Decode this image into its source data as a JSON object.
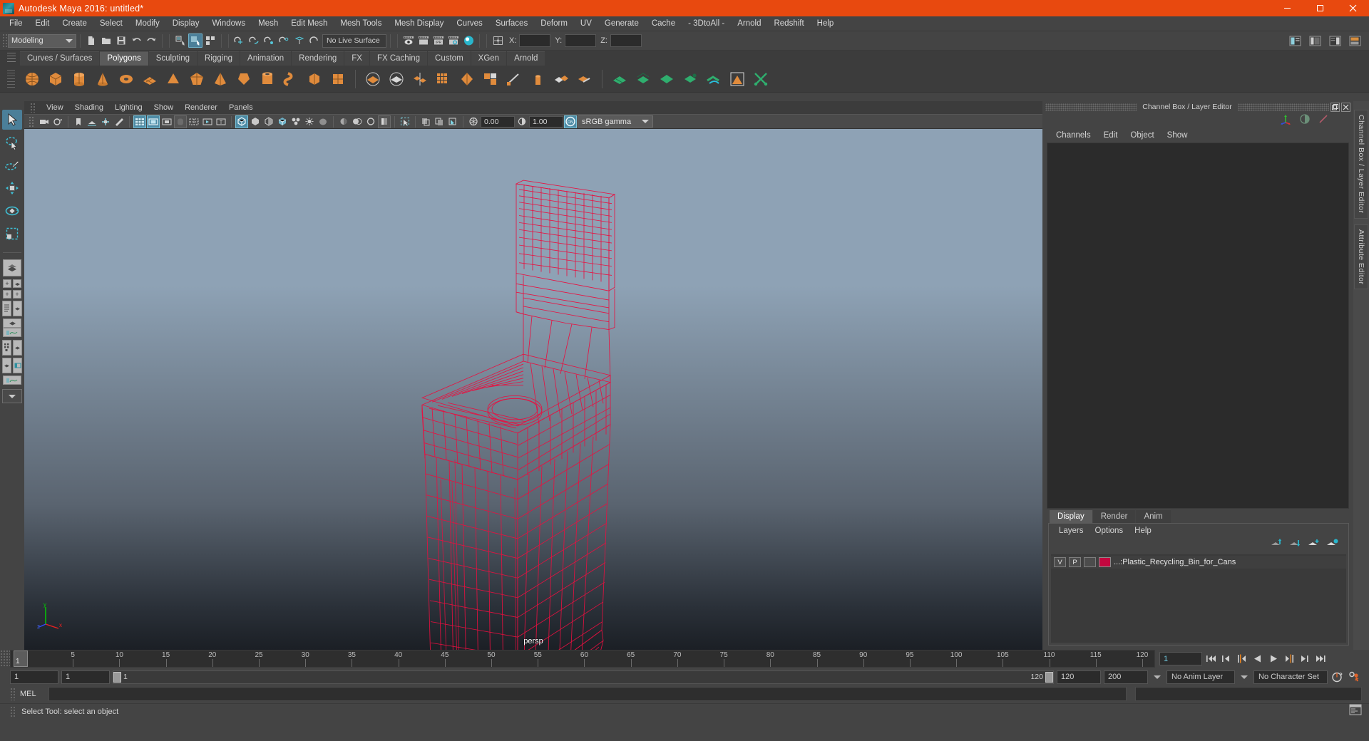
{
  "window": {
    "title": "Autodesk Maya 2016: untitled*",
    "app_icon": "maya-logo-icon",
    "controls": {
      "minimize": "–",
      "maximize": "❐",
      "close": "✕"
    }
  },
  "menubar": {
    "items": [
      "File",
      "Edit",
      "Create",
      "Select",
      "Modify",
      "Display",
      "Windows",
      "Mesh",
      "Edit Mesh",
      "Mesh Tools",
      "Mesh Display",
      "Curves",
      "Surfaces",
      "Deform",
      "UV",
      "Generate",
      "Cache",
      "- 3DtoAll -",
      "Arnold",
      "Redshift",
      "Help"
    ]
  },
  "statusline": {
    "menuset": "Modeling",
    "live_surface": "No Live Surface",
    "coord_labels": {
      "x": "X:",
      "y": "Y:",
      "z": "Z:"
    },
    "coord_values": {
      "x": "",
      "y": "",
      "z": ""
    }
  },
  "shelf": {
    "tabs": [
      "Curves / Surfaces",
      "Polygons",
      "Sculpting",
      "Rigging",
      "Animation",
      "Rendering",
      "FX",
      "FX Caching",
      "Custom",
      "XGen",
      "Arnold"
    ],
    "selected_tab": "Polygons"
  },
  "viewport": {
    "menus": [
      "View",
      "Shading",
      "Lighting",
      "Show",
      "Renderer",
      "Panels"
    ],
    "exposure": "0.00",
    "gamma_value": "1.00",
    "color_management": "sRGB gamma",
    "view_label": "persp",
    "axis": {
      "x": "x",
      "y": "y",
      "z": "z"
    },
    "model_name": "Plastic_Recycling_Bin_for_Cans",
    "wireframe_color": "#e81040",
    "background_top": "#8ea2b5",
    "background_bottom": "#1b1f25"
  },
  "channelbox": {
    "title": "Channel Box / Layer Editor",
    "menus": [
      "Channels",
      "Edit",
      "Object",
      "Show"
    ]
  },
  "layer_editor": {
    "tabs": [
      "Display",
      "Render",
      "Anim"
    ],
    "selected_tab": "Display",
    "menus": [
      "Layers",
      "Options",
      "Help"
    ],
    "rows": [
      {
        "visibility": "V",
        "playback": "P",
        "shading": "",
        "color": "#c3073f",
        "name": "...:Plastic_Recycling_Bin_for_Cans"
      }
    ]
  },
  "side_tabs": [
    "Channel Box / Layer Editor",
    "Attribute Editor"
  ],
  "timeline": {
    "start_tick": 1,
    "ticks": [
      5,
      10,
      15,
      20,
      25,
      30,
      35,
      40,
      45,
      50,
      55,
      60,
      65,
      70,
      75,
      80,
      85,
      90,
      95,
      100,
      105,
      110,
      115,
      120
    ],
    "current_frame": "1",
    "current_frame_marker": "1",
    "range_start": "1",
    "range_end": "1",
    "range_bar_start": "1",
    "range_bar_end": "120",
    "anim_end": "120",
    "playback_end": "200",
    "anim_layer": "No Anim Layer",
    "character_set": "No Character Set",
    "transport": [
      "go-to-start",
      "step-back-key",
      "step-back-frame",
      "play-backwards",
      "play-forwards",
      "step-forward-frame",
      "step-forward-key",
      "go-to-end"
    ]
  },
  "command_line": {
    "language_label": "MEL",
    "input_value": "",
    "input_placeholder": ""
  },
  "status_bar": {
    "message": "Select Tool: select an object"
  },
  "toolbox": {
    "tools": [
      "select-tool",
      "lasso-select-tool",
      "paint-select-tool",
      "move-tool",
      "rotate-tool",
      "scale-tool"
    ],
    "selected": "select-tool",
    "layouts": [
      "single-perspective-layout",
      "four-view-layout",
      "outliner-persp-layout",
      "persp-graph-layout",
      "hypershade-persp-layout",
      "persp-outliner-graph-layout",
      "more-layouts"
    ]
  }
}
